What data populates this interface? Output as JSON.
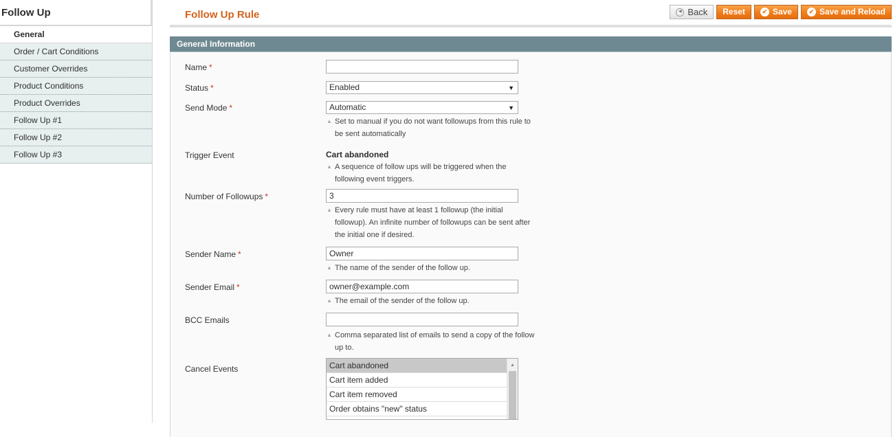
{
  "sidebar": {
    "title": "Follow Up",
    "tabs": [
      {
        "label": "General",
        "active": true
      },
      {
        "label": "Order / Cart Conditions"
      },
      {
        "label": "Customer Overrides"
      },
      {
        "label": "Product Conditions"
      },
      {
        "label": "Product Overrides"
      },
      {
        "label": "Follow Up #1"
      },
      {
        "label": "Follow Up #2"
      },
      {
        "label": "Follow Up #3"
      }
    ]
  },
  "header": {
    "title": "Follow Up Rule",
    "buttons": {
      "back": "Back",
      "reset": "Reset",
      "save": "Save",
      "save_reload": "Save and Reload"
    }
  },
  "section": {
    "title": "General Information"
  },
  "form": {
    "required_marker": "*",
    "name": {
      "label": "Name",
      "value": "",
      "required": true
    },
    "status": {
      "label": "Status",
      "value": "Enabled",
      "required": true
    },
    "send_mode": {
      "label": "Send Mode",
      "value": "Automatic",
      "required": true,
      "note_line1": "Set to manual if you do not want followups from this rule to",
      "note_line2": "be sent automatically"
    },
    "trigger_event": {
      "label": "Trigger Event",
      "value": "Cart abandoned",
      "note_line1": "A sequence of follow ups will be triggered when the",
      "note_line2": "following event triggers."
    },
    "number_followups": {
      "label": "Number of Followups",
      "value": "3",
      "required": true,
      "note_line1": "Every rule must have at least 1 followup (the initial",
      "note_line2": "followup). An infinite number of followups can be sent after",
      "note_line3": "the initial one if desired."
    },
    "sender_name": {
      "label": "Sender Name",
      "value": "Owner",
      "required": true,
      "note_line1": "The name of the sender of the follow up."
    },
    "sender_email": {
      "label": "Sender Email",
      "value": "owner@example.com",
      "required": true,
      "note_line1": "The email of the sender of the follow up."
    },
    "bcc_emails": {
      "label": "BCC Emails",
      "value": "",
      "note_line1": "Comma separated list of emails to send a copy of the follow",
      "note_line2": "up to."
    },
    "cancel_events": {
      "label": "Cancel Events",
      "options": [
        {
          "label": "Cart abandoned",
          "selected": true
        },
        {
          "label": "Cart item added"
        },
        {
          "label": "Cart item removed"
        },
        {
          "label": "Order obtains \"new\" status"
        }
      ]
    }
  },
  "colors": {
    "accent_orange": "#ef7b18",
    "title_orange": "#d3621b",
    "section_header": "#6f8992",
    "tab_bg": "#e7efef",
    "required": "#c0392b"
  }
}
